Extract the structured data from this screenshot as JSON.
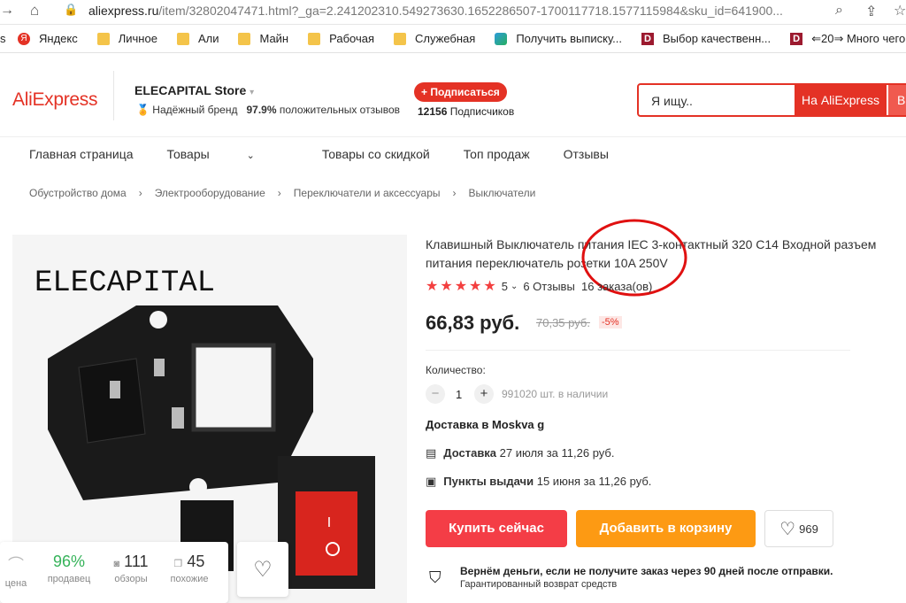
{
  "browser": {
    "url_host": "aliexpress.ru",
    "url_rest": "/item/32802047471.html?_ga=2.241202310.549273630.1652286507-1700117718.1577115984&sku_id=641900...",
    "bookmarks": [
      {
        "label": "Яндекс",
        "icon": "yandex-icon"
      },
      {
        "label": "Личное",
        "icon": "folder-icon"
      },
      {
        "label": "Али",
        "icon": "folder-icon"
      },
      {
        "label": "Майн",
        "icon": "folder-icon"
      },
      {
        "label": "Рабочая",
        "icon": "folder-icon"
      },
      {
        "label": "Служебная",
        "icon": "folder-icon"
      },
      {
        "label": "Получить выписку...",
        "icon": "leaf-icon"
      },
      {
        "label": "Выбор качественн...",
        "icon": "d-icon"
      },
      {
        "label": "⇐20⇒ Много чего...",
        "icon": "d-icon"
      }
    ]
  },
  "header": {
    "logo": "AliExpress",
    "store_name": "ELECAPITAL Store",
    "trusted": "Надёжный бренд",
    "positive_pct": "97.9%",
    "positive_label": "положительных отзывов",
    "subscribe": "+ Подписаться",
    "subscribers_count": "12156",
    "subscribers_label": "Подписчиков",
    "search_placeholder": "Я ищу..",
    "search_button": "На AliExpress",
    "search_button2": "В"
  },
  "nav": [
    "Главная страница",
    "Товары",
    "Товары со скидкой",
    "Топ продаж",
    "Отзывы"
  ],
  "breadcrumb": [
    "Обустройство дома",
    "Электрооборудование",
    "Переключатели и аксессуары",
    "Выключатели"
  ],
  "product": {
    "image_brand": "ELECAPITAL",
    "title": "Клавишный Выключатель питания IEC 3-контактный 320 C14 Входной разъем питания переключатель розетки 10A 250V",
    "rating": "5",
    "reviews": "6 Отзывы",
    "orders": "16 заказа(ов)",
    "price": "66,83 руб.",
    "old_price": "70,35 руб.",
    "discount": "-5%",
    "qty_label": "Количество:",
    "qty_value": "1",
    "available": "991020 шт. в наличии",
    "delivery_to": "Доставка в Moskva g",
    "delivery1_bold": "Доставка",
    "delivery1_rest": "27 июля за 11,26 руб.",
    "delivery2_bold": "Пункты выдачи",
    "delivery2_rest": "15 июня за 11,26 руб.",
    "buy_now": "Купить сейчас",
    "add_to_cart": "Добавить в корзину",
    "wish_count": "969",
    "guarantee_title": "Вернём деньги, если не получите заказ через 90 дней после отправки.",
    "guarantee_sub": "Гарантированный возврат средств"
  },
  "stats": [
    {
      "value": "",
      "label": "цена"
    },
    {
      "value": "96%",
      "label": "продавец"
    },
    {
      "value": "111",
      "label": "обзоры"
    },
    {
      "value": "45",
      "label": "похожие"
    }
  ],
  "colors": {
    "accent": "#e43225",
    "buy": "#f43d46",
    "cart": "#fd9a13",
    "stars": "#f33f3f"
  }
}
